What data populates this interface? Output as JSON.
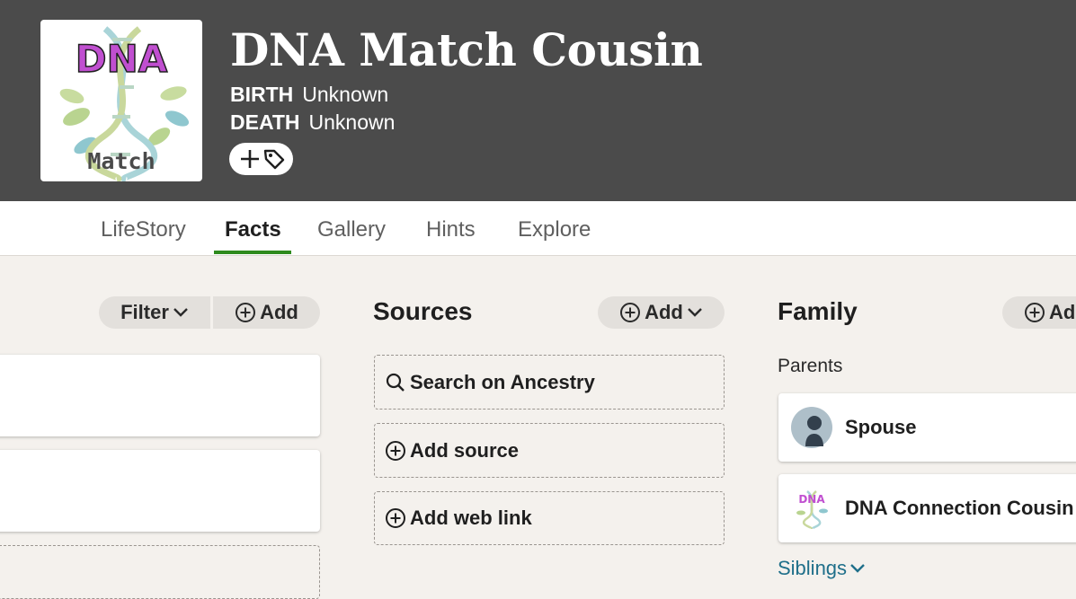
{
  "profile": {
    "name": "DNA Match Cousin",
    "birth_label": "BIRTH",
    "birth_value": "Unknown",
    "death_label": "DEATH",
    "death_value": "Unknown",
    "avatar_text_top": "DNA",
    "avatar_text_bottom": "Match"
  },
  "tabs": [
    {
      "label": "LifeStory",
      "active": false
    },
    {
      "label": "Facts",
      "active": true
    },
    {
      "label": "Gallery",
      "active": false
    },
    {
      "label": "Hints",
      "active": false
    },
    {
      "label": "Explore",
      "active": false
    }
  ],
  "facts": {
    "filter_label": "Filter",
    "add_label": "Add"
  },
  "sources": {
    "title": "Sources",
    "add_label": "Add",
    "actions": [
      {
        "label": "Search on Ancestry",
        "icon": "search-icon"
      },
      {
        "label": "Add source",
        "icon": "plus-circle-icon"
      },
      {
        "label": "Add web link",
        "icon": "plus-circle-icon"
      }
    ]
  },
  "family": {
    "title": "Family",
    "add_label": "Add",
    "parents_label": "Parents",
    "parents": [
      {
        "name": "Spouse",
        "avatar": "silhouette-avatar"
      },
      {
        "name": "DNA Connection Cousin",
        "avatar": "dna-logo-avatar",
        "avatar_text": "DNA"
      }
    ],
    "siblings_label": "Siblings"
  },
  "colors": {
    "header_bg": "#4b4b4b",
    "page_bg": "#f4f1ed",
    "active_tab_underline": "#2e8b1e",
    "link": "#1f6f8a",
    "dna_purple": "#c04fd0"
  }
}
